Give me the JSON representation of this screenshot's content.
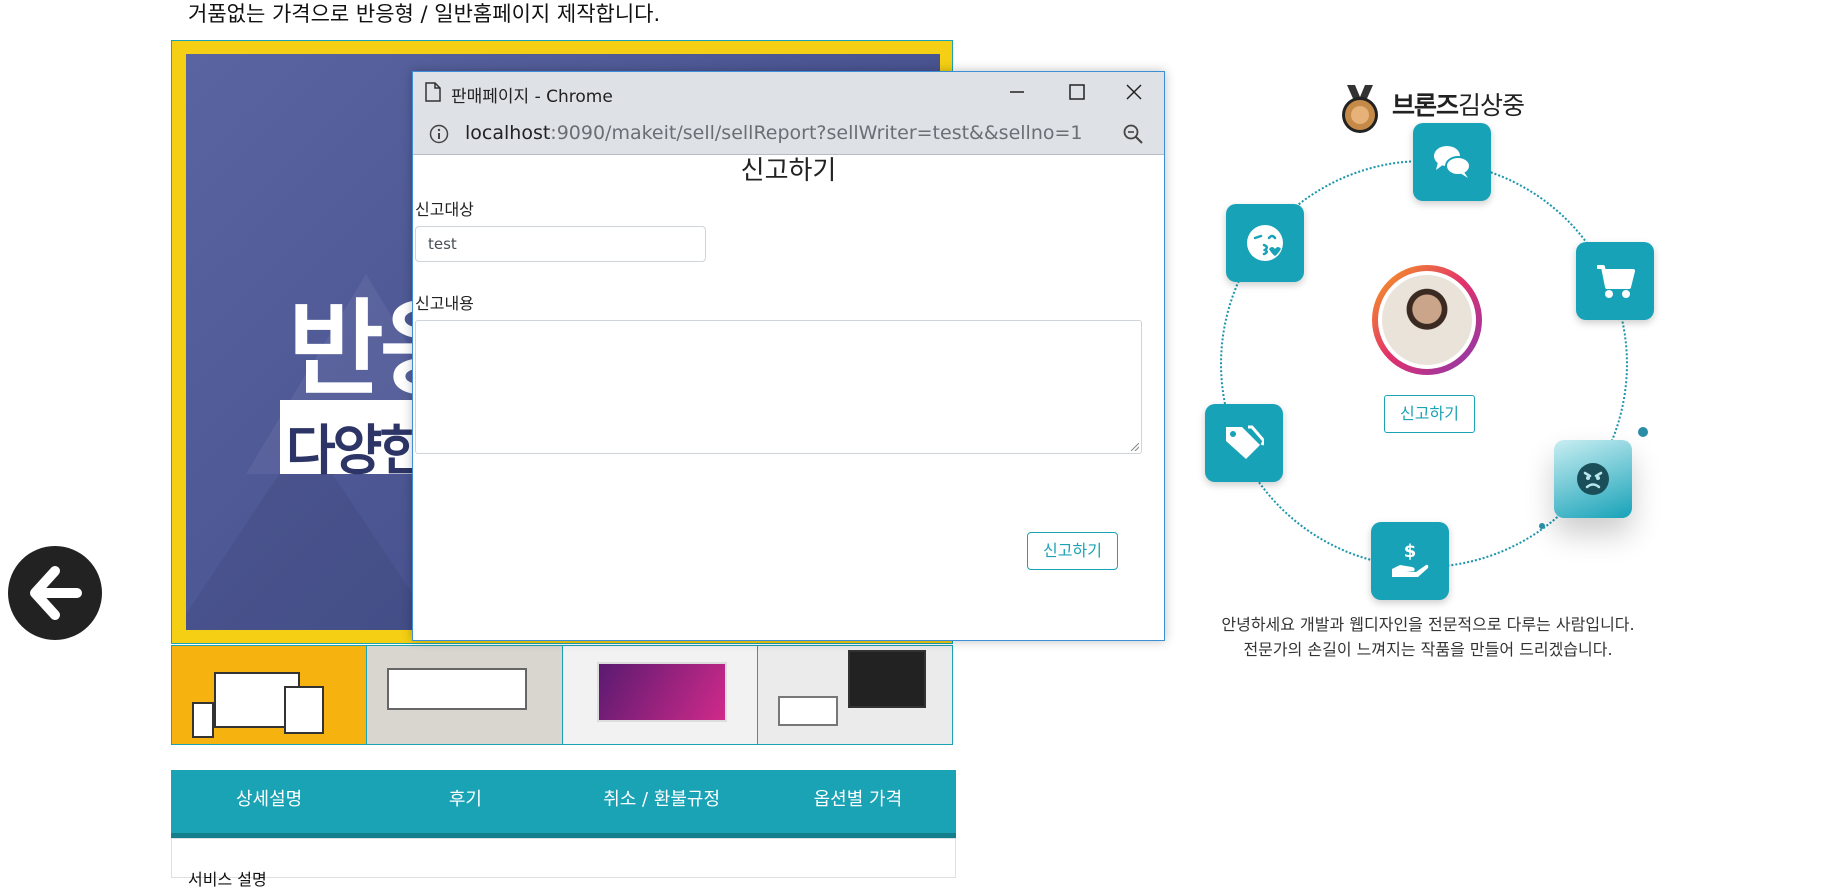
{
  "page": {
    "description": "거품없는 가격으로 반응형 / 일반홈페이지 제작합니다.",
    "main_image": {
      "headline": "반응",
      "subline": "다양한"
    },
    "tabs": [
      "상세설명",
      "후기",
      "취소 / 환불규정",
      "옵션별 가격"
    ],
    "content_title": "서비스 설명"
  },
  "popup": {
    "window_title": "판매페이지 - Chrome",
    "url_host": "localhost",
    "url_rest": ":9090/makeit/sell/sellReport?sellWriter=test&&sellno=1",
    "heading": "신고하기",
    "target_label": "신고대상",
    "target_value": "test",
    "content_label": "신고내용",
    "content_value": "",
    "submit_label": "신고하기"
  },
  "profile": {
    "grade": "브론즈",
    "name": "김상중",
    "report_button": "신고하기",
    "bio_line1": "안녕하세요 개발과 웹디자인을 전문적으로 다루는 사람입니다.",
    "bio_line2": "전문가의 손길이 느껴지는 작품을 만들어 드리겠습니다.",
    "orbit_icons": [
      "chat-icon",
      "cart-icon",
      "angry-face-icon",
      "money-hand-icon",
      "tags-icon",
      "kiss-face-icon"
    ]
  },
  "colors": {
    "accent": "#1aa3b5",
    "frame": "#f4cf14",
    "banner": "#4a5491"
  }
}
